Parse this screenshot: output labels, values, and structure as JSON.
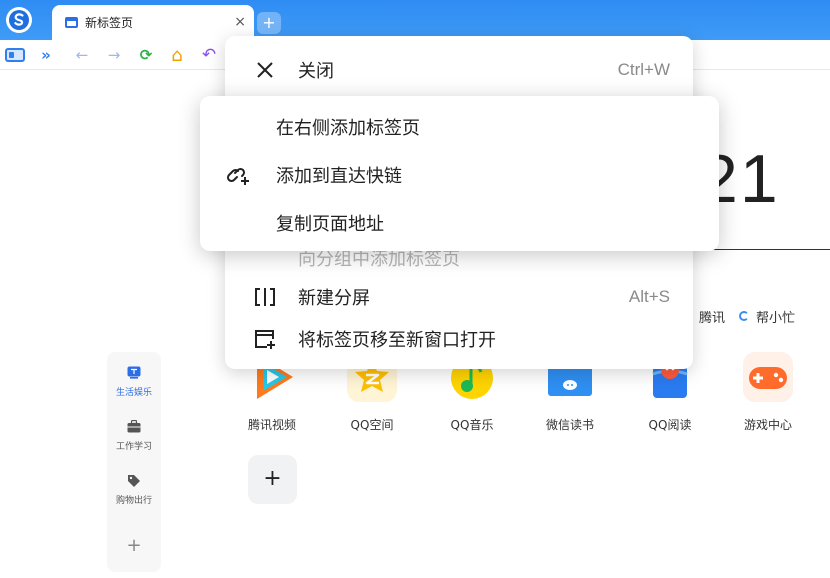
{
  "browser": {
    "tab_title": "新标签页",
    "tab_close": "×",
    "new_tab": "+"
  },
  "toolbar": {
    "expand": "»",
    "back": "←",
    "forward": "→",
    "refresh": "⟳",
    "home": "⌂",
    "undo": "↶"
  },
  "main": {
    "clock": "21",
    "links": [
      "腾讯",
      "帮小忙"
    ],
    "apps": [
      {
        "label": "腾讯视频"
      },
      {
        "label": "QQ空间"
      },
      {
        "label": "QQ音乐"
      },
      {
        "label": "微信读书"
      },
      {
        "label": "QQ阅读"
      },
      {
        "label": "游戏中心"
      }
    ],
    "add_tile": "+"
  },
  "sidebar": {
    "items": [
      {
        "label": "生活娱乐"
      },
      {
        "label": "工作学习"
      },
      {
        "label": "购物出行"
      }
    ],
    "add": "+"
  },
  "context_menu": {
    "items": [
      {
        "label": "关闭",
        "shortcut": "Ctrl+W"
      },
      {
        "label": "向分组中添加标签页"
      },
      {
        "label": "新建分屏",
        "shortcut": "Alt+S"
      },
      {
        "label": "将标签页移至新窗口打开"
      }
    ]
  },
  "submenu": {
    "items": [
      {
        "label": "在右侧添加标签页"
      },
      {
        "label": "添加到直达快链"
      },
      {
        "label": "复制页面地址"
      }
    ]
  },
  "colors": {
    "titlebar": "#2f8cf3",
    "accent": "#2c6ee6",
    "refresh": "#2fb14a",
    "home": "#f2a200",
    "undo": "#8a4ff0"
  }
}
